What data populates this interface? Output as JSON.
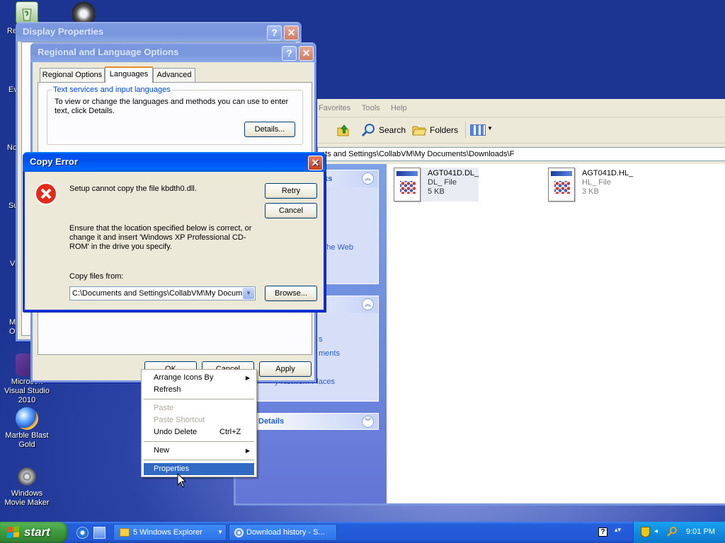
{
  "desktop": {
    "icons": [
      {
        "label": "Recycle Bin"
      },
      {
        "label": ""
      },
      {
        "label": "Microsoft Visual Studio 2010"
      },
      {
        "label": "Marble Blast Gold"
      },
      {
        "label": "Windows Movie Maker"
      }
    ],
    "partial_labels": [
      "Re",
      "Ev",
      "Nc",
      "Su",
      "Vi",
      "M O"
    ]
  },
  "explorer": {
    "menu": [
      "Favorites",
      "Tools",
      "Help"
    ],
    "toolbar": {
      "search": "Search",
      "folders": "Folders"
    },
    "address": "nts and Settings\\CollabVM\\My Documents\\Downloads\\F",
    "tasks_fragment": "sks",
    "web_link_fragment": "o the Web",
    "links_fragments": [
      "s",
      "ments",
      "y Network Places"
    ],
    "details_label": "Details",
    "files": [
      {
        "name": "AGT041D.DL_",
        "type": "DL_ File",
        "size": "5 KB"
      },
      {
        "name": "AGT041D.HL_",
        "type": "HL_ File",
        "size": "3 KB"
      }
    ]
  },
  "display_properties": {
    "title": "Display Properties",
    "help": "?",
    "close": "✕"
  },
  "regional": {
    "title": "Regional and Language Options",
    "help": "?",
    "close": "✕",
    "tabs": [
      "Regional Options",
      "Languages",
      "Advanced"
    ],
    "group_label": "Text services and input languages",
    "group_text": "To view or change the languages and methods you can use to enter text, click Details.",
    "details_button": "Details...",
    "ok": "OK",
    "cancel": "Cancel",
    "apply": "Apply"
  },
  "copy_error": {
    "title": "Copy Error",
    "close": "✕",
    "message": "Setup cannot copy the file kbdth0.dll.",
    "instructions": "Ensure that the location specified below is correct, or change it and insert 'Windows XP Professional CD-ROM' in the drive you specify.",
    "copy_from_label": "Copy files from:",
    "path_value": "C:\\Documents and Settings\\CollabVM\\My Docum",
    "retry": "Retry",
    "cancel": "Cancel",
    "browse": "Browse..."
  },
  "context_menu": {
    "arrange": "Arrange Icons By",
    "refresh": "Refresh",
    "paste": "Paste",
    "paste_shortcut": "Paste Shortcut",
    "undo_delete": "Undo Delete",
    "undo_shortcut": "Ctrl+Z",
    "new": "New",
    "properties": "Properties"
  },
  "taskbar": {
    "start": "start",
    "items": [
      {
        "label": "5 Windows Explorer"
      },
      {
        "label": "Download history - S..."
      }
    ],
    "clock": "9:01 PM"
  },
  "colors": {
    "titlebar_active": "#0053ee",
    "taskbar": "#245edb",
    "start_button": "#3c9a3c",
    "menu_highlight": "#316ac5"
  }
}
